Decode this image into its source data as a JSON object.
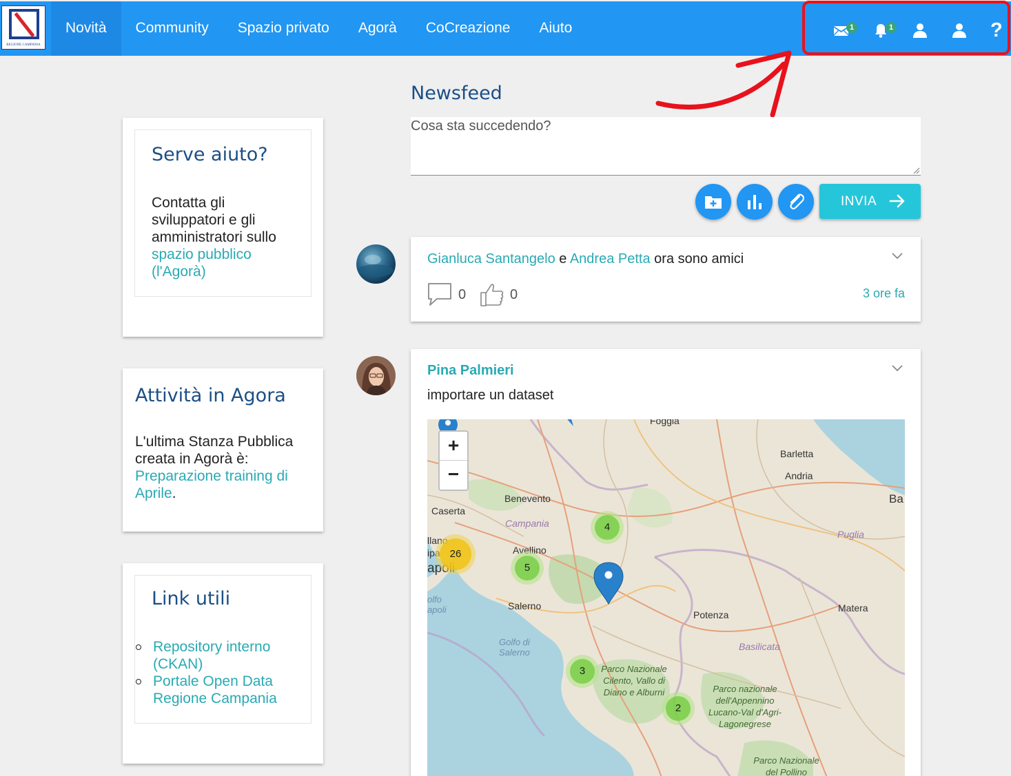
{
  "app": {
    "logo_text": "REGIONE CAMPANIA",
    "nav": [
      "Novità",
      "Community",
      "Spazio privato",
      "Agorà",
      "CoCreazione",
      "Aiuto"
    ],
    "messages_badge": "1",
    "notifications_badge": "1",
    "help_label": "?",
    "colors": {
      "navbar": "#2196f3",
      "accent": "#29aab3",
      "highlight": "#e8121c"
    }
  },
  "sidebar": {
    "help_card": {
      "title": "Serve aiuto?",
      "text": "Contatta gli sviluppatori e gli amministratori sullo",
      "link": "spazio pubblico (l'Agorà)"
    },
    "agora_card": {
      "title": "Attività in Agora",
      "text": "L'ultima Stanza Pubblica creata in Agorà è:",
      "link": "Preparazione training di Aprile",
      "suffix": "."
    },
    "links_card": {
      "title": "Link utili",
      "links": [
        "Repository interno (CKAN)",
        "Portale Open Data Regione Campania"
      ]
    }
  },
  "newsfeed": {
    "title": "Newsfeed",
    "compose_placeholder": "Cosa sta succedendo?",
    "send_label": "INVIA",
    "post1": {
      "user1": "Gianluca Santangelo",
      "connector": "e",
      "user2": "Andrea Petta",
      "text": "ora sono amici",
      "comments": "0",
      "likes": "0",
      "time": "3 ore fa"
    },
    "post2": {
      "user": "Pina Palmieri",
      "text": "importare un dataset",
      "map": {
        "zoom_in": "+",
        "zoom_out": "−",
        "places": [
          "Foggia",
          "Barletta",
          "Andria",
          "Ba",
          "Benevento",
          "Caserta",
          "Avellino",
          "Salerno",
          "Potenza",
          "Matera",
          "llano",
          "ipa",
          "apoli"
        ],
        "regions": [
          "Campania",
          "Puglia",
          "Basilicata"
        ],
        "sea": [
          "Golfo di Salerno",
          "olfo apoli"
        ],
        "parks": [
          "Parco Nazionale Cilento, Vallo di Diano e Alburni",
          "Parco nazionale dell'Appennino Lucano-Val d'Agri-Lagonegrese",
          "Parco Nazionale del Pollino"
        ],
        "clusters": [
          "26",
          "5",
          "4",
          "3",
          "2"
        ]
      }
    }
  }
}
